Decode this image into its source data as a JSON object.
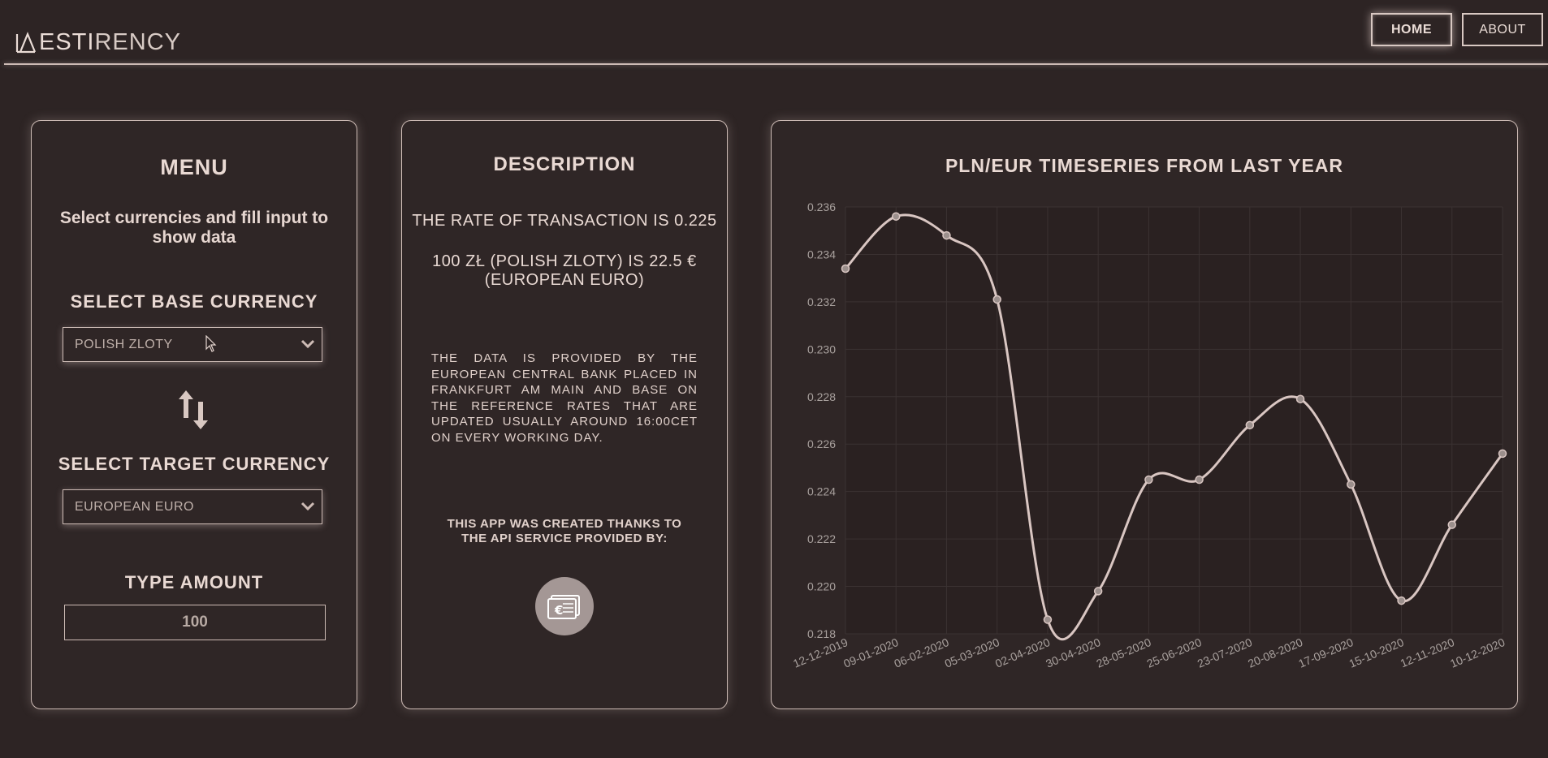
{
  "header": {
    "logo_light": "ESTI",
    "logo_bold": "RENCY",
    "nav": {
      "home": "HOME",
      "about": "ABOUT"
    }
  },
  "menu": {
    "title": "MENU",
    "subtitle": "Select currencies and fill input to show data",
    "base_label": "SELECT BASE CURRENCY",
    "base_value": "POLISH ZLOTY",
    "target_label": "SELECT TARGET CURRENCY",
    "target_value": "EUROPEAN EURO",
    "amount_label": "TYPE AMOUNT",
    "amount_value": "100"
  },
  "description": {
    "title": "DESCRIPTION",
    "rate_text": "THE RATE OF TRANSACTION IS 0.225",
    "conversion_text": "100 ZŁ (POLISH ZLOTY) IS 22.5 € (EUROPEAN EURO)",
    "info_text": "THE DATA IS PROVIDED BY THE EUROPEAN CENTRAL BANK PLACED IN FRANKFURT AM MAIN AND BASE ON THE REFERENCE RATES THAT ARE UPDATED USUALLY AROUND 16:00CET ON EVERY WORKING DAY.",
    "credit_text": "THIS APP WAS CREATED THANKS TO THE API SERVICE PROVIDED BY:"
  },
  "chart_data": {
    "type": "line",
    "title": "PLN/EUR TIMESERIES FROM LAST YEAR",
    "xlabel": "",
    "ylabel": "",
    "categories": [
      "12-12-2019",
      "09-01-2020",
      "06-02-2020",
      "05-03-2020",
      "02-04-2020",
      "30-04-2020",
      "28-05-2020",
      "25-06-2020",
      "23-07-2020",
      "20-08-2020",
      "17-09-2020",
      "15-10-2020",
      "12-11-2020",
      "10-12-2020"
    ],
    "series": [
      {
        "values": [
          0.2334,
          0.2356,
          0.2348,
          0.2321,
          0.2186,
          0.2198,
          0.2245,
          0.2245,
          0.2268,
          0.2279,
          0.2243,
          0.2194,
          0.2226,
          0.2256
        ]
      }
    ],
    "ylim": [
      0.218,
      0.236
    ],
    "yticks": [
      "0.236",
      "0.234",
      "0.232",
      "0.230",
      "0.228",
      "0.226",
      "0.224",
      "0.222",
      "0.220",
      "0.218"
    ],
    "grid": true,
    "legend": "none",
    "line_color": "#d9c6c2"
  }
}
